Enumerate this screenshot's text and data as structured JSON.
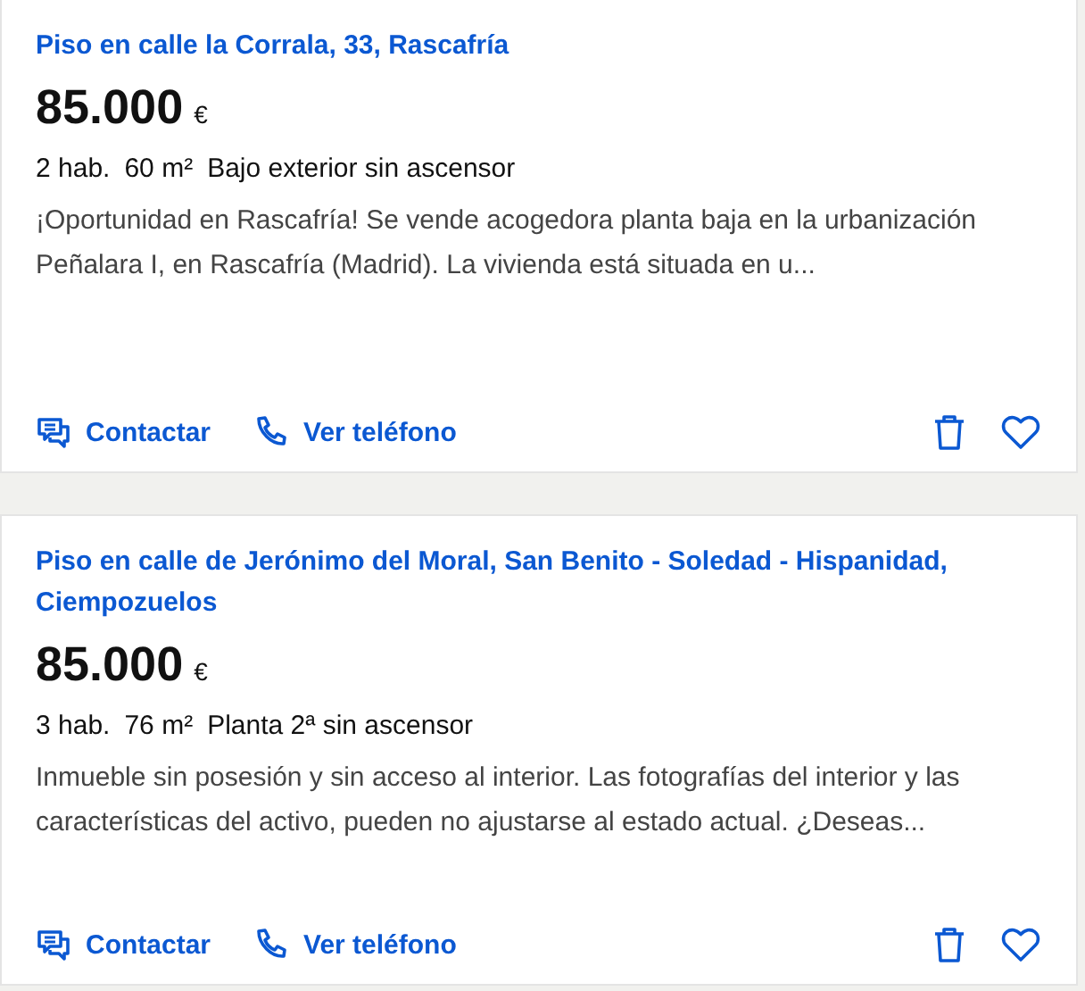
{
  "listings": [
    {
      "title": "Piso en calle la Corrala, 33, Rascafría",
      "price": "85.000",
      "currency": "€",
      "features": [
        "2 hab.",
        "60 m²",
        "Bajo exterior sin ascensor"
      ],
      "description": "¡Oportunidad en Rascafría! Se vende acogedora planta baja en la urbanización Peñalara I, en Rascafría (Madrid). La vivienda está situada en u...",
      "actions": [
        {
          "kind": "contact",
          "label": "Contactar"
        },
        {
          "kind": "phone",
          "label": "Ver teléfono"
        }
      ],
      "favorite": false
    },
    {
      "title": "Piso en calle de Jerónimo del Moral, San Benito - Soledad - Hispanidad, Ciempozuelos",
      "price": "85.000",
      "currency": "€",
      "features": [
        "3 hab.",
        "76 m²",
        "Planta 2ª sin ascensor"
      ],
      "description": "Inmueble sin posesión y sin acceso al interior. Las fotografías del interior y las características del activo, pueden no ajustarse al estado actual. ¿Deseas...",
      "actions": [
        {
          "kind": "contact",
          "label": "Contactar"
        },
        {
          "kind": "phone",
          "label": "Ver teléfono"
        }
      ],
      "favorite": false
    }
  ]
}
